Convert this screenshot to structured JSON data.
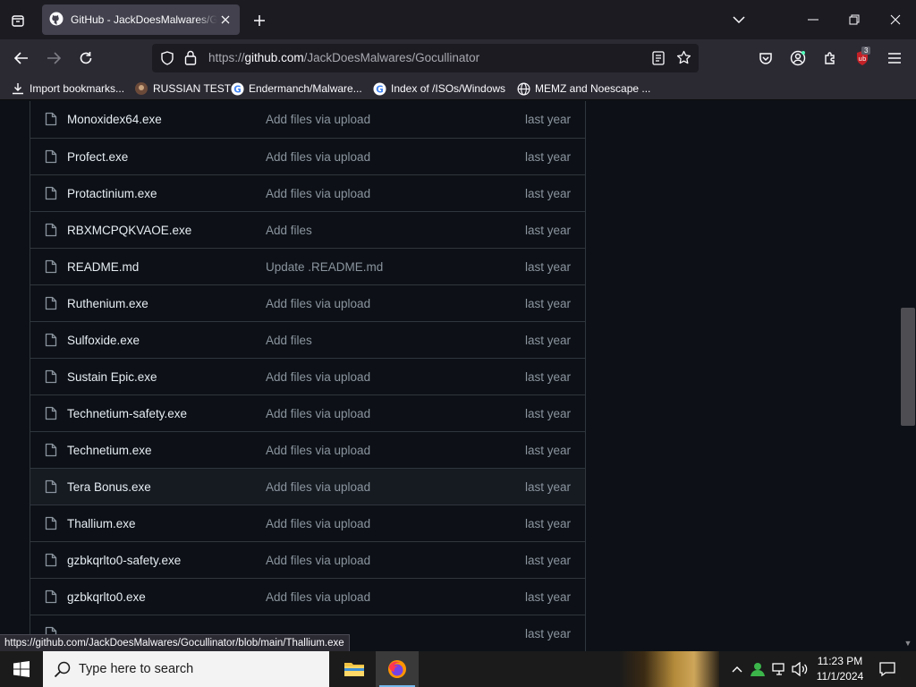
{
  "browser": {
    "tab_title": "GitHub - JackDoesMalwares/Gocullinator",
    "url_scheme": "https://",
    "url_host": "github.com",
    "url_path": "/JackDoesMalwares/Gocullinator",
    "bookmarks": [
      {
        "label": "Import bookmarks...",
        "icon": "import-icon"
      },
      {
        "label": "RUSSIAN TEST",
        "icon": "site-favicon"
      },
      {
        "label": "Endermanch/Malware...",
        "icon": "google-favicon"
      },
      {
        "label": "Index of /ISOs/Windows",
        "icon": "google-favicon"
      },
      {
        "label": "MEMZ and Noescape ...",
        "icon": "globe-icon"
      }
    ],
    "extension_badge": "3",
    "status_url": "https://github.com/JackDoesMalwares/Gocullinator/blob/main/Thallium.exe"
  },
  "files": [
    {
      "name": "Monoxidex64.exe",
      "message": "Add files via upload",
      "date": "last year"
    },
    {
      "name": "Profect.exe",
      "message": "Add files via upload",
      "date": "last year"
    },
    {
      "name": "Protactinium.exe",
      "message": "Add files via upload",
      "date": "last year"
    },
    {
      "name": "RBXMCPQKVAOE.exe",
      "message": "Add files",
      "date": "last year"
    },
    {
      "name": "README.md",
      "message": "Update .README.md",
      "date": "last year"
    },
    {
      "name": "Ruthenium.exe",
      "message": "Add files via upload",
      "date": "last year"
    },
    {
      "name": "Sulfoxide.exe",
      "message": "Add files",
      "date": "last year"
    },
    {
      "name": "Sustain Epic.exe",
      "message": "Add files via upload",
      "date": "last year"
    },
    {
      "name": "Technetium-safety.exe",
      "message": "Add files via upload",
      "date": "last year"
    },
    {
      "name": "Technetium.exe",
      "message": "Add files via upload",
      "date": "last year"
    },
    {
      "name": "Tera Bonus.exe",
      "message": "Add files via upload",
      "date": "last year"
    },
    {
      "name": "Thallium.exe",
      "message": "Add files via upload",
      "date": "last year"
    },
    {
      "name": "gzbkqrlto0-safety.exe",
      "message": "Add files via upload",
      "date": "last year"
    },
    {
      "name": "gzbkqrlto0.exe",
      "message": "Add files via upload",
      "date": "last year"
    },
    {
      "name": "",
      "message": "",
      "date": "last year"
    }
  ],
  "taskbar": {
    "search_placeholder": "Type here to search",
    "time": "11:23 PM",
    "date": "11/1/2024"
  },
  "colors": {
    "page_bg": "#0d1117",
    "border": "#30363d",
    "text_primary": "#e6edf3",
    "text_muted": "#8b949e",
    "browser_chrome": "#2b2a33",
    "ublock_red": "#c32127"
  }
}
